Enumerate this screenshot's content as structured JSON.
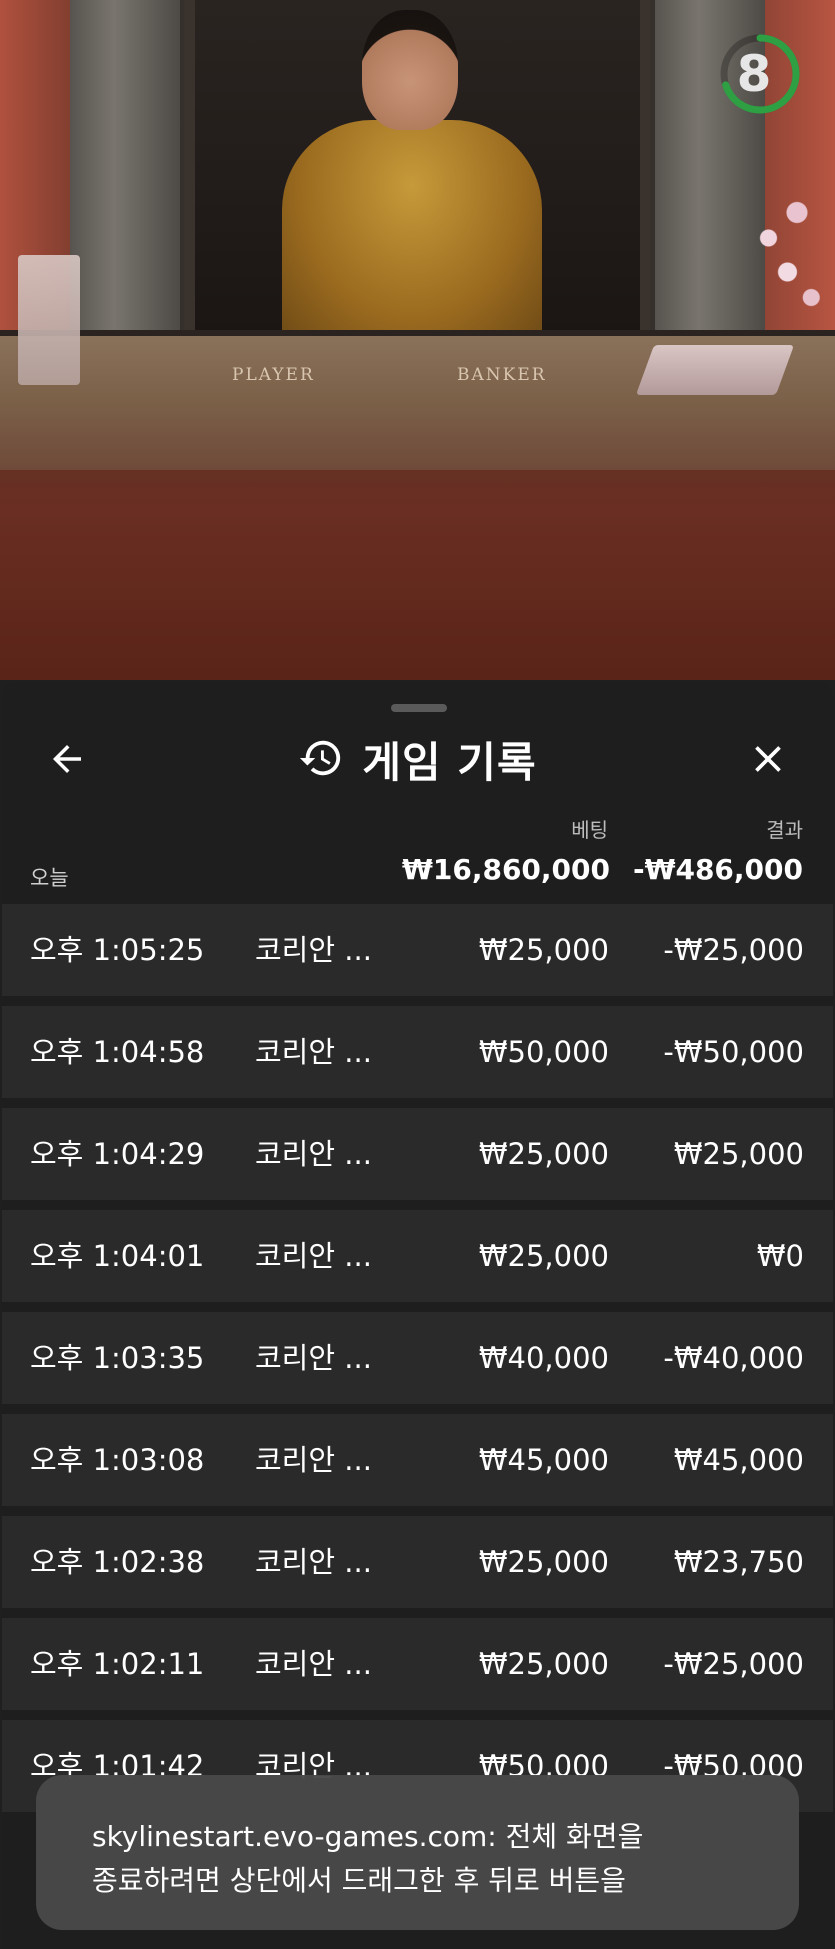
{
  "video": {
    "table_labels": {
      "player": "PLAYER",
      "banker": "BANKER"
    },
    "timer": {
      "value": "8",
      "progress_fraction": 0.7,
      "ring_color": "#2ea043"
    }
  },
  "sheet": {
    "title": "게임 기록",
    "icons": {
      "back": "arrow-left-icon",
      "history": "history-icon",
      "close": "close-icon"
    },
    "summary": {
      "bet_label": "베팅",
      "result_label": "결과",
      "period_label": "오늘",
      "total_bet": "₩16,860,000",
      "total_result": "-₩486,000"
    },
    "rows": [
      {
        "time": "오후 1:05:25",
        "game": "코리안 ...",
        "bet": "₩25,000",
        "result": "-₩25,000"
      },
      {
        "time": "오후 1:04:58",
        "game": "코리안 ...",
        "bet": "₩50,000",
        "result": "-₩50,000"
      },
      {
        "time": "오후 1:04:29",
        "game": "코리안 ...",
        "bet": "₩25,000",
        "result": "₩25,000"
      },
      {
        "time": "오후 1:04:01",
        "game": "코리안 ...",
        "bet": "₩25,000",
        "result": "₩0"
      },
      {
        "time": "오후 1:03:35",
        "game": "코리안 ...",
        "bet": "₩40,000",
        "result": "-₩40,000"
      },
      {
        "time": "오후 1:03:08",
        "game": "코리안 ...",
        "bet": "₩45,000",
        "result": "₩45,000"
      },
      {
        "time": "오후 1:02:38",
        "game": "코리안 ...",
        "bet": "₩25,000",
        "result": "₩23,750"
      },
      {
        "time": "오후 1:02:11",
        "game": "코리안 ...",
        "bet": "₩25,000",
        "result": "-₩25,000"
      },
      {
        "time": "오후 1:01:42",
        "game": "코리안 ...",
        "bet": "₩50,000",
        "result": "-₩50,000"
      }
    ]
  },
  "toast": {
    "line1": "skylinestart.evo-games.com: 전체 화면을",
    "line2": "종료하려면 상단에서 드래그한 후 뒤로 버튼을"
  }
}
